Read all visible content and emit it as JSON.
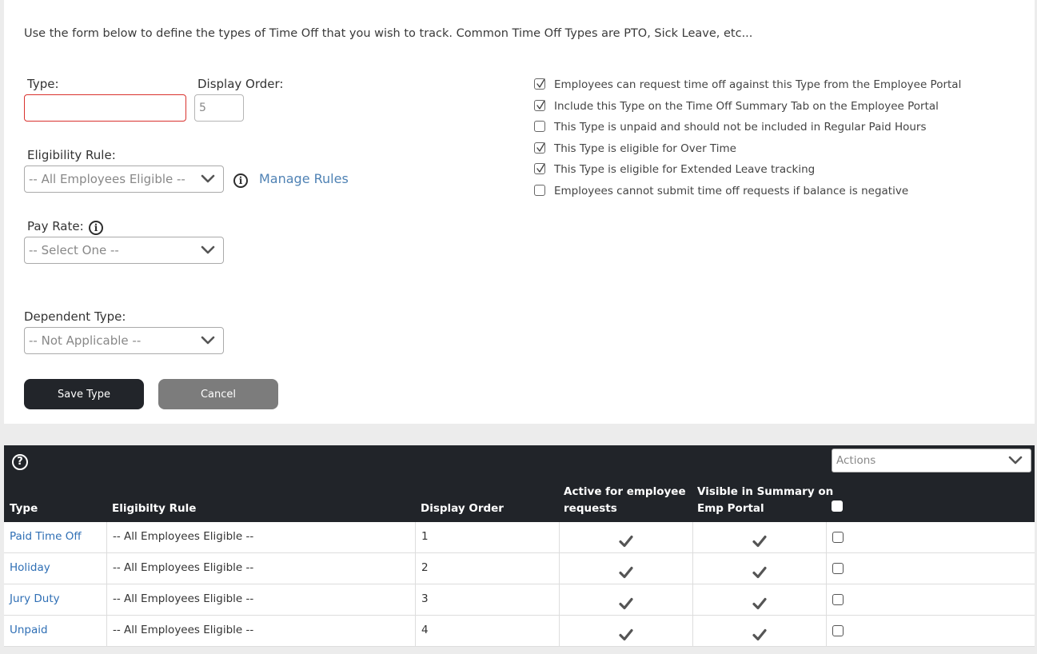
{
  "intro": "Use the form below to define the types of Time Off that you wish to track. Common Time Off Types are PTO, Sick Leave, etc...",
  "form": {
    "type_label": "Type:",
    "type_value": "",
    "display_order_label": "Display Order:",
    "display_order_value": "5",
    "eligibility_label": "Eligibility Rule:",
    "eligibility_selected": "-- All Employees Eligible --",
    "manage_rules": "Manage Rules",
    "pay_rate_label": "Pay Rate:",
    "pay_rate_selected": "-- Select One --",
    "dependent_label": "Dependent Type:",
    "dependent_selected": "-- Not Applicable --",
    "save_label": "Save Type",
    "cancel_label": "Cancel"
  },
  "options": [
    {
      "label": "Employees can request time off against this Type from the Employee Portal",
      "checked": true
    },
    {
      "label": "Include this Type on the Time Off Summary Tab on the Employee Portal",
      "checked": true
    },
    {
      "label": "This Type is unpaid and should not be included in Regular Paid Hours",
      "checked": false
    },
    {
      "label": "This Type is eligible for Over Time",
      "checked": true
    },
    {
      "label": "This Type is eligible for Extended Leave tracking",
      "checked": true
    },
    {
      "label": "Employees cannot submit time off requests if balance is negative",
      "checked": false
    }
  ],
  "table": {
    "actions_label": "Actions",
    "headers": {
      "type": "Type",
      "rule": "Eligibilty Rule",
      "order": "Display Order",
      "active_1": "Active for employee",
      "active_2": "requests",
      "visible_1": "Visible in Summary on",
      "visible_2": "Emp Portal"
    },
    "rows": [
      {
        "type": "Paid Time Off",
        "rule": "-- All Employees Eligible --",
        "order": "1",
        "active": true,
        "visible": true
      },
      {
        "type": "Holiday",
        "rule": "-- All Employees Eligible --",
        "order": "2",
        "active": true,
        "visible": true
      },
      {
        "type": "Jury Duty",
        "rule": "-- All Employees Eligible --",
        "order": "3",
        "active": true,
        "visible": true
      },
      {
        "type": "Unpaid",
        "rule": "-- All Employees Eligible --",
        "order": "4",
        "active": true,
        "visible": true
      }
    ]
  },
  "colors": {
    "link": "#4f82b4",
    "table_header": "#212429",
    "save_button": "#22252a",
    "cancel_button": "#7c7c7c",
    "invalid_border": "#d9322e"
  }
}
